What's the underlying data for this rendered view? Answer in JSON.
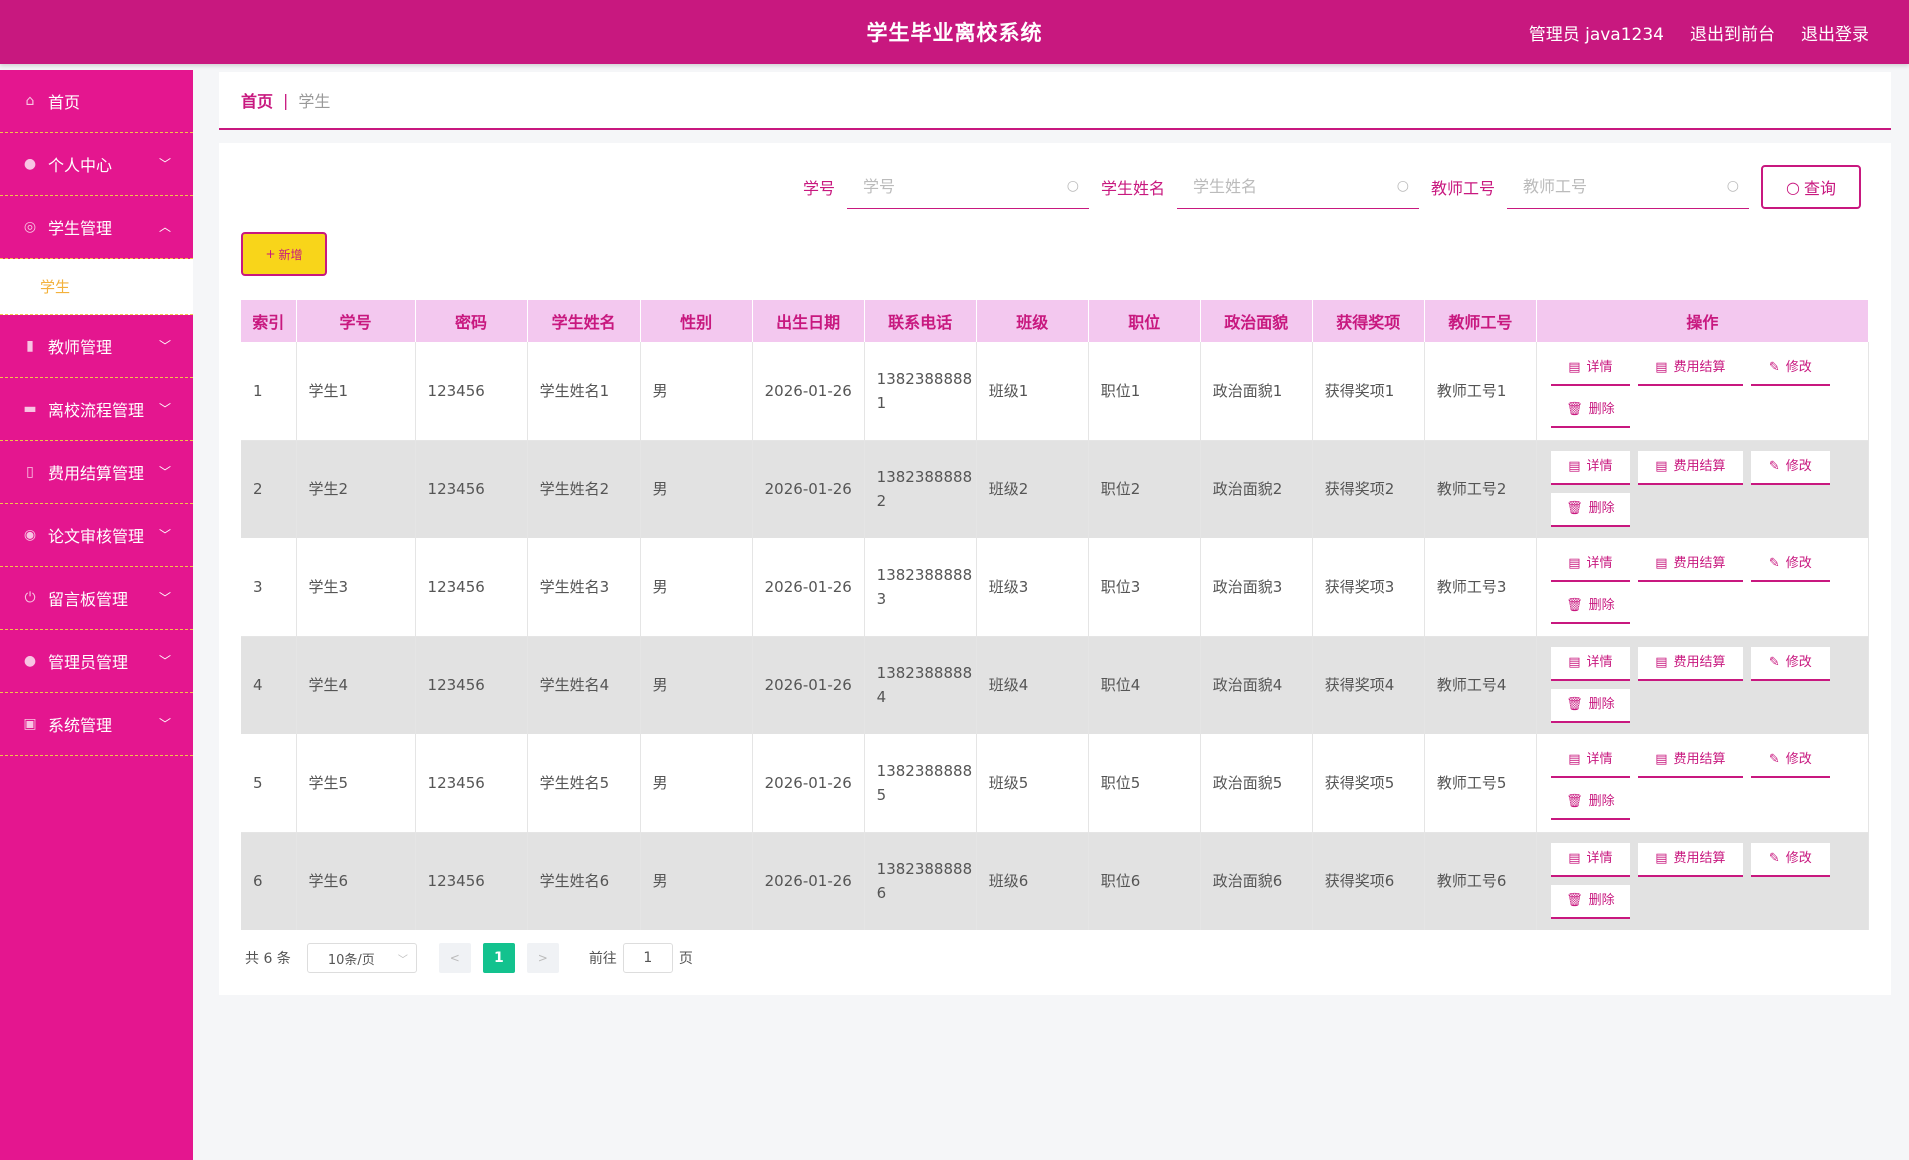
{
  "header": {
    "title": "学生毕业离校系统",
    "admin_label": "管理员 java1234",
    "exit_front": "退出到前台",
    "logout": "退出登录"
  },
  "sidebar": {
    "items": [
      {
        "label": "首页",
        "icon": "home-icon"
      },
      {
        "label": "个人中心",
        "icon": "user-icon"
      },
      {
        "label": "学生管理",
        "icon": "compass-icon"
      },
      {
        "label": "教师管理",
        "icon": "bar-chart-icon"
      },
      {
        "label": "离校流程管理",
        "icon": "briefcase-icon"
      },
      {
        "label": "费用结算管理",
        "icon": "microphone-icon"
      },
      {
        "label": "论文审核管理",
        "icon": "target-icon"
      },
      {
        "label": "留言板管理",
        "icon": "power-icon"
      },
      {
        "label": "管理员管理",
        "icon": "user-icon"
      },
      {
        "label": "系统管理",
        "icon": "box-icon"
      }
    ],
    "submenu_student": "学生"
  },
  "breadcrumb": {
    "home": "首页",
    "sep": "|",
    "current": "学生"
  },
  "search": {
    "label_xuehao": "学号",
    "ph_xuehao": "学号",
    "label_name": "学生姓名",
    "ph_name": "学生姓名",
    "label_teacher": "教师工号",
    "ph_teacher": "教师工号",
    "query_btn": "查询"
  },
  "add_btn": "新增",
  "table": {
    "columns": [
      "索引",
      "学号",
      "密码",
      "学生姓名",
      "性别",
      "出生日期",
      "联系电话",
      "班级",
      "职位",
      "政治面貌",
      "获得奖项",
      "教师工号",
      "操作"
    ],
    "rows": [
      [
        "1",
        "学生1",
        "123456",
        "学生姓名1",
        "男",
        "2026-01-26",
        "13823888881",
        "班级1",
        "职位1",
        "政治面貌1",
        "获得奖项1",
        "教师工号1"
      ],
      [
        "2",
        "学生2",
        "123456",
        "学生姓名2",
        "男",
        "2026-01-26",
        "13823888882",
        "班级2",
        "职位2",
        "政治面貌2",
        "获得奖项2",
        "教师工号2"
      ],
      [
        "3",
        "学生3",
        "123456",
        "学生姓名3",
        "男",
        "2026-01-26",
        "13823888883",
        "班级3",
        "职位3",
        "政治面貌3",
        "获得奖项3",
        "教师工号3"
      ],
      [
        "4",
        "学生4",
        "123456",
        "学生姓名4",
        "男",
        "2026-01-26",
        "13823888884",
        "班级4",
        "职位4",
        "政治面貌4",
        "获得奖项4",
        "教师工号4"
      ],
      [
        "5",
        "学生5",
        "123456",
        "学生姓名5",
        "男",
        "2026-01-26",
        "13823888885",
        "班级5",
        "职位5",
        "政治面貌5",
        "获得奖项5",
        "教师工号5"
      ],
      [
        "6",
        "学生6",
        "123456",
        "学生姓名6",
        "男",
        "2026-01-26",
        "13823888886",
        "班级6",
        "职位6",
        "政治面貌6",
        "获得奖项6",
        "教师工号6"
      ]
    ],
    "ops": {
      "detail": "详情",
      "fee": "费用结算",
      "edit": "修改",
      "delete": "删除"
    }
  },
  "pager": {
    "total": "共 6 条",
    "page_size": "10条/页",
    "current_page": "1",
    "goto_prefix": "前往",
    "goto_value": "1",
    "goto_suffix": "页"
  },
  "colors": {
    "header": "#c8187f",
    "sidebar": "#e4168f",
    "accent": "#c8187f",
    "add_button": "#f8d51a",
    "table_header": "#f3c8ef",
    "active_page": "#13c28e"
  }
}
